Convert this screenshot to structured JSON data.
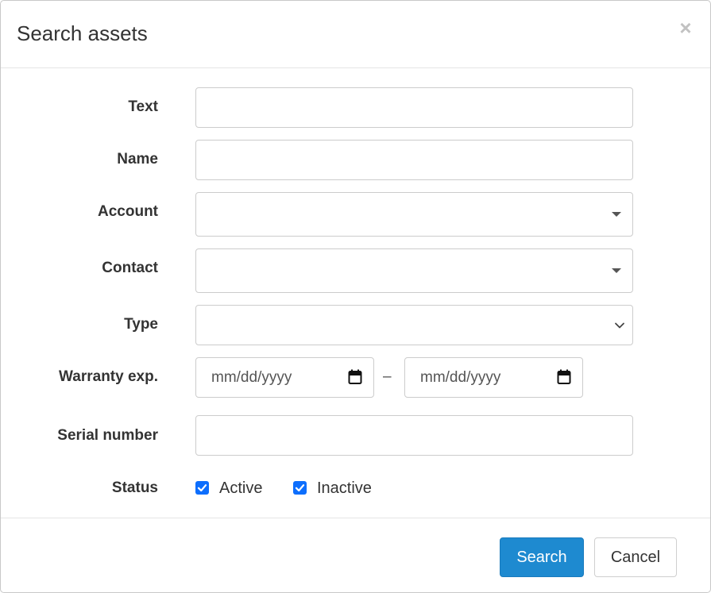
{
  "dialog": {
    "title": "Search assets",
    "close_symbol": "×"
  },
  "form": {
    "text": {
      "label": "Text",
      "value": "",
      "placeholder": ""
    },
    "name": {
      "label": "Name",
      "value": "",
      "placeholder": ""
    },
    "account": {
      "label": "Account",
      "value": ""
    },
    "contact": {
      "label": "Contact",
      "value": ""
    },
    "type": {
      "label": "Type",
      "value": ""
    },
    "warranty": {
      "label": "Warranty exp.",
      "from_placeholder": "mm/dd/yyyy",
      "separator": "–",
      "to_placeholder": "mm/dd/yyyy"
    },
    "serial": {
      "label": "Serial number",
      "value": "",
      "placeholder": ""
    },
    "status": {
      "label": "Status",
      "options": [
        {
          "label": "Active",
          "checked": true
        },
        {
          "label": "Inactive",
          "checked": true
        }
      ]
    }
  },
  "footer": {
    "search_label": "Search",
    "cancel_label": "Cancel"
  },
  "colors": {
    "primary": "#1e8ad0",
    "checkbox": "#0d6efd"
  },
  "icons": {
    "close": "close-icon",
    "dropdown": "caret-down-icon",
    "select": "chevron-down-icon",
    "calendar": "calendar-icon",
    "check": "checkmark-icon"
  }
}
